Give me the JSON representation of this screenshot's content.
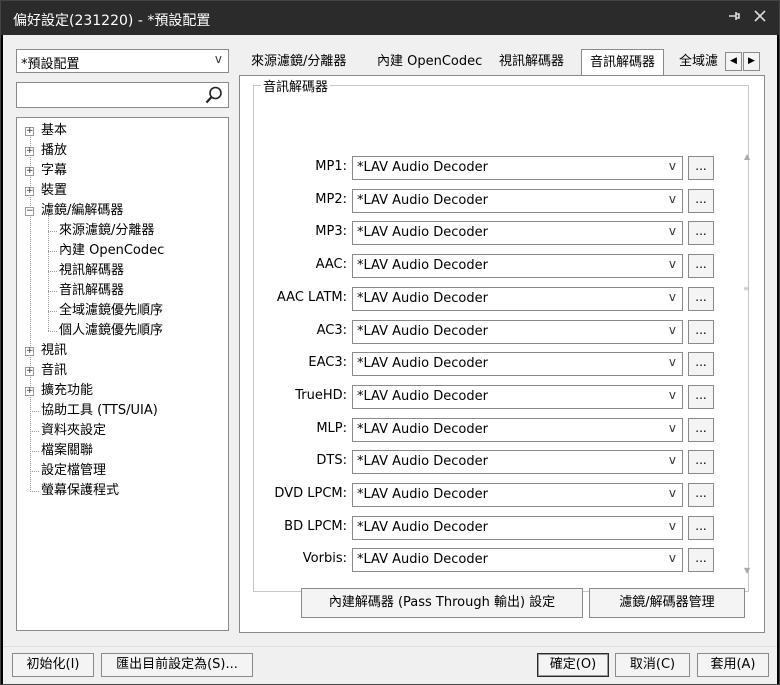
{
  "window": {
    "title": "偏好設定(231220) - *預設配置"
  },
  "profile_combo": {
    "value": "*預設配置"
  },
  "tree": [
    {
      "label": "基本",
      "expander": "+",
      "level": 0
    },
    {
      "label": "播放",
      "expander": "+",
      "level": 0
    },
    {
      "label": "字幕",
      "expander": "+",
      "level": 0
    },
    {
      "label": "裝置",
      "expander": "+",
      "level": 0
    },
    {
      "label": "濾鏡/編解碼器",
      "expander": "−",
      "level": 0
    },
    {
      "label": "來源濾鏡/分離器",
      "expander": "",
      "level": 1
    },
    {
      "label": "內建 OpenCodec",
      "expander": "",
      "level": 1
    },
    {
      "label": "視訊解碼器",
      "expander": "",
      "level": 1
    },
    {
      "label": "音訊解碼器",
      "expander": "",
      "level": 1
    },
    {
      "label": "全域濾鏡優先順序",
      "expander": "",
      "level": 1
    },
    {
      "label": "個人濾鏡優先順序",
      "expander": "",
      "level": 1
    },
    {
      "label": "視訊",
      "expander": "+",
      "level": 0
    },
    {
      "label": "音訊",
      "expander": "+",
      "level": 0
    },
    {
      "label": "擴充功能",
      "expander": "+",
      "level": 0
    },
    {
      "label": "協助工具 (TTS/UIA)",
      "expander": "",
      "level": 0
    },
    {
      "label": "資料夾設定",
      "expander": "",
      "level": 0
    },
    {
      "label": "檔案關聯",
      "expander": "",
      "level": 0
    },
    {
      "label": "設定檔管理",
      "expander": "",
      "level": 0
    },
    {
      "label": "螢幕保護程式",
      "expander": "",
      "level": 0
    }
  ],
  "tabs": [
    {
      "label": "來源濾鏡/分離器",
      "active": false
    },
    {
      "label": "內建 OpenCodec",
      "active": false
    },
    {
      "label": "視訊解碼器",
      "active": false
    },
    {
      "label": "音訊解碼器",
      "active": true
    },
    {
      "label": "全域濾",
      "active": false
    }
  ],
  "tab_scroll": {
    "left": "◀",
    "right": "▶"
  },
  "group": {
    "title": "音訊解碼器"
  },
  "decoders": [
    {
      "label": "MP1:",
      "value": "*LAV Audio Decoder"
    },
    {
      "label": "MP2:",
      "value": "*LAV Audio Decoder"
    },
    {
      "label": "MP3:",
      "value": "*LAV Audio Decoder"
    },
    {
      "label": "AAC:",
      "value": "*LAV Audio Decoder"
    },
    {
      "label": "AAC LATM:",
      "value": "*LAV Audio Decoder"
    },
    {
      "label": "AC3:",
      "value": "*LAV Audio Decoder"
    },
    {
      "label": "EAC3:",
      "value": "*LAV Audio Decoder"
    },
    {
      "label": "TrueHD:",
      "value": "*LAV Audio Decoder"
    },
    {
      "label": "MLP:",
      "value": "*LAV Audio Decoder"
    },
    {
      "label": "DTS:",
      "value": "*LAV Audio Decoder"
    },
    {
      "label": "DVD LPCM:",
      "value": "*LAV Audio Decoder"
    },
    {
      "label": "BD LPCM:",
      "value": "*LAV Audio Decoder"
    },
    {
      "label": "Vorbis:",
      "value": "*LAV Audio Decoder"
    }
  ],
  "more_button_label": "...",
  "dropdown_arrow": "v",
  "panel_buttons": {
    "passthrough": "內建解碼器 (Pass Through 輸出) 設定",
    "manage": "濾鏡/解碼器管理"
  },
  "bottom_buttons": {
    "reset": "初始化(I)",
    "export": "匯出目前設定為(S)...",
    "ok": "確定(O)",
    "cancel": "取消(C)",
    "apply": "套用(A)"
  },
  "titlebar_icons": {
    "pin": "pin-icon",
    "close": "close-icon"
  }
}
